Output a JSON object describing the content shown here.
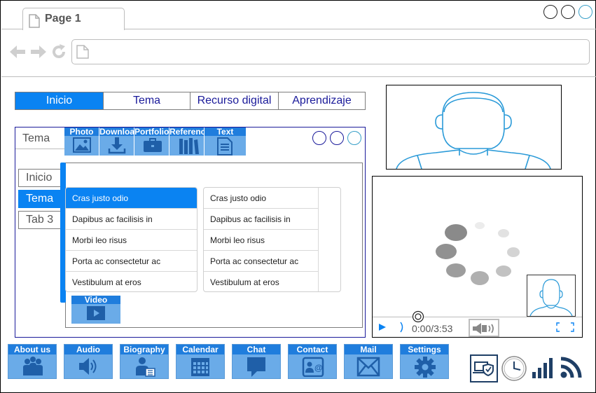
{
  "browser": {
    "tab_title": "Page 1",
    "url": ""
  },
  "nav_tabs": [
    {
      "label": "Inicio",
      "active": true
    },
    {
      "label": "Tema",
      "active": false
    },
    {
      "label": "Recurso digital",
      "active": false
    },
    {
      "label": "Aprendizaje",
      "active": false
    }
  ],
  "tema_panel": {
    "title": "Tema",
    "toolbar": [
      {
        "label": "Photo",
        "icon": "image-icon"
      },
      {
        "label": "Download",
        "icon": "download-icon"
      },
      {
        "label": "Portfolio",
        "icon": "briefcase-icon"
      },
      {
        "label": "References",
        "icon": "books-icon"
      },
      {
        "label": "Text",
        "icon": "document-icon"
      }
    ],
    "vertical_tabs": [
      {
        "label": "Inicio",
        "active": false
      },
      {
        "label": "Tema",
        "active": true
      },
      {
        "label": "Tab 3",
        "active": false
      }
    ],
    "list_left": [
      {
        "label": "Cras justo odio",
        "active": true
      },
      {
        "label": "Dapibus ac facilisis in",
        "active": false
      },
      {
        "label": "Morbi leo risus",
        "active": false
      },
      {
        "label": "Porta ac consectetur ac",
        "active": false
      },
      {
        "label": "Vestibulum at eros",
        "active": false
      }
    ],
    "list_right": [
      {
        "label": "Cras justo odio",
        "active": false
      },
      {
        "label": "Dapibus ac facilisis in",
        "active": false
      },
      {
        "label": "Morbi leo risus",
        "active": false
      },
      {
        "label": "Porta ac consectetur ac",
        "active": false
      },
      {
        "label": "Vestibulum at eros",
        "active": false
      }
    ],
    "video_button": "Video"
  },
  "player": {
    "time": "0:00/3:53"
  },
  "bottom_buttons": [
    {
      "label": "About us",
      "icon": "group-icon"
    },
    {
      "label": "Audio",
      "icon": "speaker-icon"
    },
    {
      "label": "Biography",
      "icon": "person-book-icon"
    },
    {
      "label": "Calendar",
      "icon": "calendar-icon"
    },
    {
      "label": "Chat",
      "icon": "chat-icon"
    },
    {
      "label": "Contact",
      "icon": "contact-icon"
    },
    {
      "label": "Mail",
      "icon": "mail-icon"
    },
    {
      "label": "Settings",
      "icon": "gear-icon"
    }
  ],
  "status_icons": [
    "secure-laptop-icon",
    "clock-icon",
    "signal-icon",
    "wifi-icon"
  ],
  "colors": {
    "accent": "#0a83f2",
    "button_fill": "#6aabe8",
    "button_label": "#1f7ddd",
    "link_text": "#1a1a9a"
  }
}
